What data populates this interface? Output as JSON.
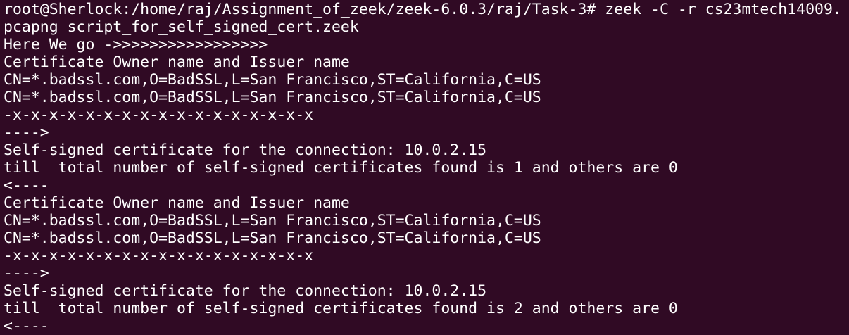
{
  "terminal": {
    "lines": [
      "root@Sherlock:/home/raj/Assignment_of_zeek/zeek-6.0.3/raj/Task-3# zeek -C -r cs23mtech14009.",
      "pcapng script_for_self_signed_cert.zeek",
      "Here We go ->>>>>>>>>>>>>>>>>",
      "Certificate Owner name and Issuer name",
      "CN=*.badssl.com,O=BadSSL,L=San Francisco,ST=California,C=US",
      "CN=*.badssl.com,O=BadSSL,L=San Francisco,ST=California,C=US",
      "-x-x-x-x-x-x-x-x-x-x-x-x-x-x-x-x-x",
      "---->",
      "Self-signed certificate for the connection: 10.0.2.15",
      "till  total number of self-signed certificates found is 1 and others are 0",
      "<----",
      "Certificate Owner name and Issuer name",
      "CN=*.badssl.com,O=BadSSL,L=San Francisco,ST=California,C=US",
      "CN=*.badssl.com,O=BadSSL,L=San Francisco,ST=California,C=US",
      "-x-x-x-x-x-x-x-x-x-x-x-x-x-x-x-x-x",
      "---->",
      "Self-signed certificate for the connection: 10.0.2.15",
      "till  total number of self-signed certificates found is 2 and others are 0",
      "<----"
    ]
  },
  "colors": {
    "background": "#300a24",
    "foreground": "#ffffff"
  }
}
